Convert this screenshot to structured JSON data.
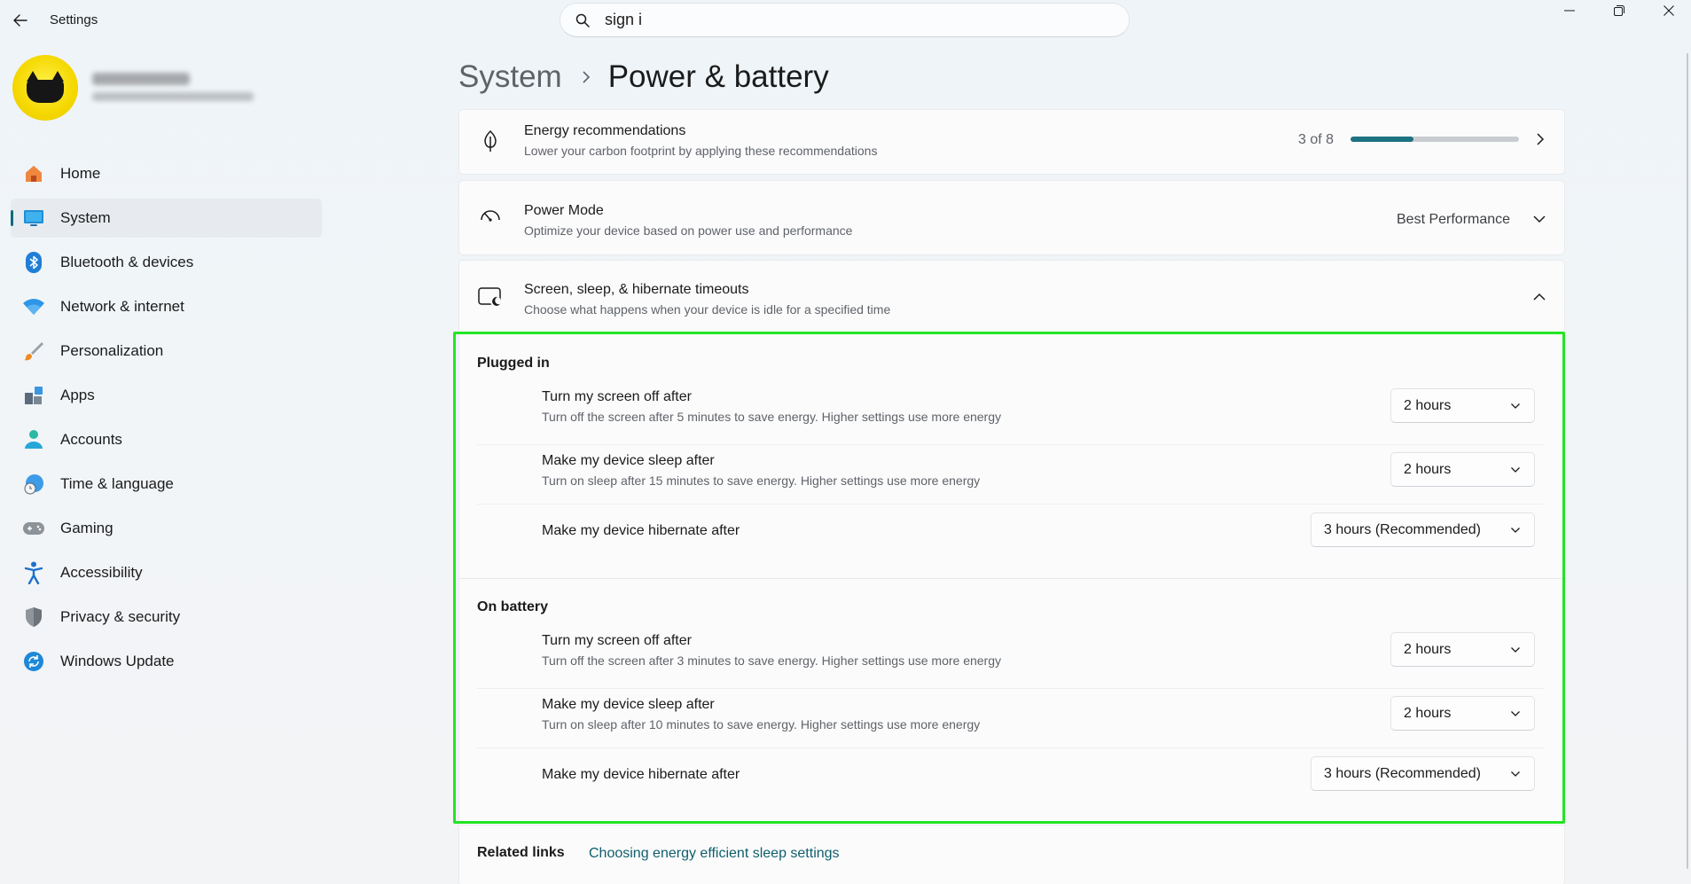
{
  "window": {
    "title": "Settings",
    "search": {
      "value": "sign i",
      "placeholder": "Find a setting"
    }
  },
  "sidebar": {
    "items": [
      {
        "label": "Home",
        "icon": "home-icon"
      },
      {
        "label": "System",
        "icon": "system-icon",
        "active": true
      },
      {
        "label": "Bluetooth & devices",
        "icon": "bluetooth-icon"
      },
      {
        "label": "Network & internet",
        "icon": "wifi-icon"
      },
      {
        "label": "Personalization",
        "icon": "brush-icon"
      },
      {
        "label": "Apps",
        "icon": "apps-icon"
      },
      {
        "label": "Accounts",
        "icon": "accounts-icon"
      },
      {
        "label": "Time & language",
        "icon": "globe-clock-icon"
      },
      {
        "label": "Gaming",
        "icon": "gamepad-icon"
      },
      {
        "label": "Accessibility",
        "icon": "accessibility-icon"
      },
      {
        "label": "Privacy & security",
        "icon": "shield-icon"
      },
      {
        "label": "Windows Update",
        "icon": "update-icon"
      }
    ]
  },
  "breadcrumb": {
    "parent": "System",
    "current": "Power & battery"
  },
  "energy": {
    "title": "Energy recommendations",
    "desc": "Lower your carbon footprint by applying these recommendations",
    "progress_text": "3 of 8",
    "progress_fraction": 0.375
  },
  "power_mode": {
    "title": "Power Mode",
    "desc": "Optimize your device based on power use and performance",
    "value": "Best Performance"
  },
  "timeouts": {
    "title": "Screen, sleep, & hibernate timeouts",
    "desc": "Choose what happens when your device is idle for a specified time",
    "plugged_in": {
      "label": "Plugged in",
      "screen_title": "Turn my screen off after",
      "screen_desc": "Turn off the screen after 5 minutes to save energy. Higher settings use more energy",
      "screen_value": "2 hours",
      "sleep_title": "Make my device sleep after",
      "sleep_desc": "Turn on sleep after 15 minutes to save energy. Higher settings use more energy",
      "sleep_value": "2 hours",
      "hibernate_title": "Make my device hibernate after",
      "hibernate_value": "3 hours (Recommended)"
    },
    "on_battery": {
      "label": "On battery",
      "screen_title": "Turn my screen off after",
      "screen_desc": "Turn off the screen after 3 minutes to save energy. Higher settings use more energy",
      "screen_value": "2 hours",
      "sleep_title": "Make my device sleep after",
      "sleep_desc": "Turn on sleep after 10 minutes to save energy. Higher settings use more energy",
      "sleep_value": "2 hours",
      "hibernate_title": "Make my device hibernate after",
      "hibernate_value": "3 hours (Recommended)"
    }
  },
  "related": {
    "label": "Related links",
    "link": "Choosing energy efficient sleep settings"
  },
  "colors": {
    "accent": "#0f6c7a",
    "highlight": "#22e524"
  }
}
